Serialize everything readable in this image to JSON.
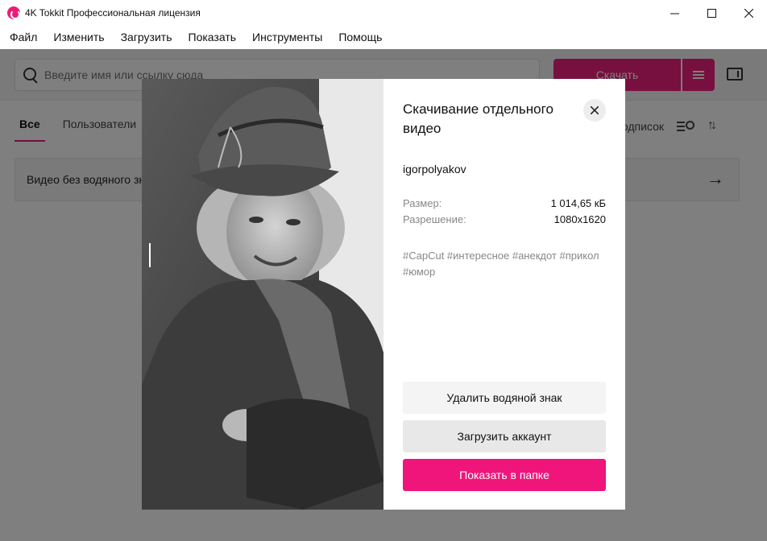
{
  "window": {
    "title": "4K Tokkit Профессиональная лицензия"
  },
  "menu": [
    "Файл",
    "Изменить",
    "Загрузить",
    "Показать",
    "Инструменты",
    "Помощь"
  ],
  "toolbar": {
    "search_placeholder": "Введите имя или ссылку сюда",
    "download_label": "Скачать"
  },
  "tabs": [
    {
      "label": "Все",
      "active": true
    },
    {
      "label": "Пользователи",
      "active": false
    }
  ],
  "right_tools": {
    "subscriptions_label": "Подписок"
  },
  "list": {
    "row_label": "Видео без водяного знака"
  },
  "modal": {
    "title": "Скачивание отдельного видео",
    "author": "igorpolyakov",
    "size_label": "Размер:",
    "size_value": "1 014,65 кБ",
    "resolution_label": "Разрешение:",
    "resolution_value": "1080x1620",
    "hashtags": "#CapCut #интересное #анекдот #прикол #юмор",
    "buttons": {
      "remove_watermark": "Удалить водяной знак",
      "load_account": "Загрузить аккаунт",
      "show_in_folder": "Показать в папке"
    }
  },
  "colors": {
    "accent": "#f0157a",
    "overlay": "#000000"
  }
}
